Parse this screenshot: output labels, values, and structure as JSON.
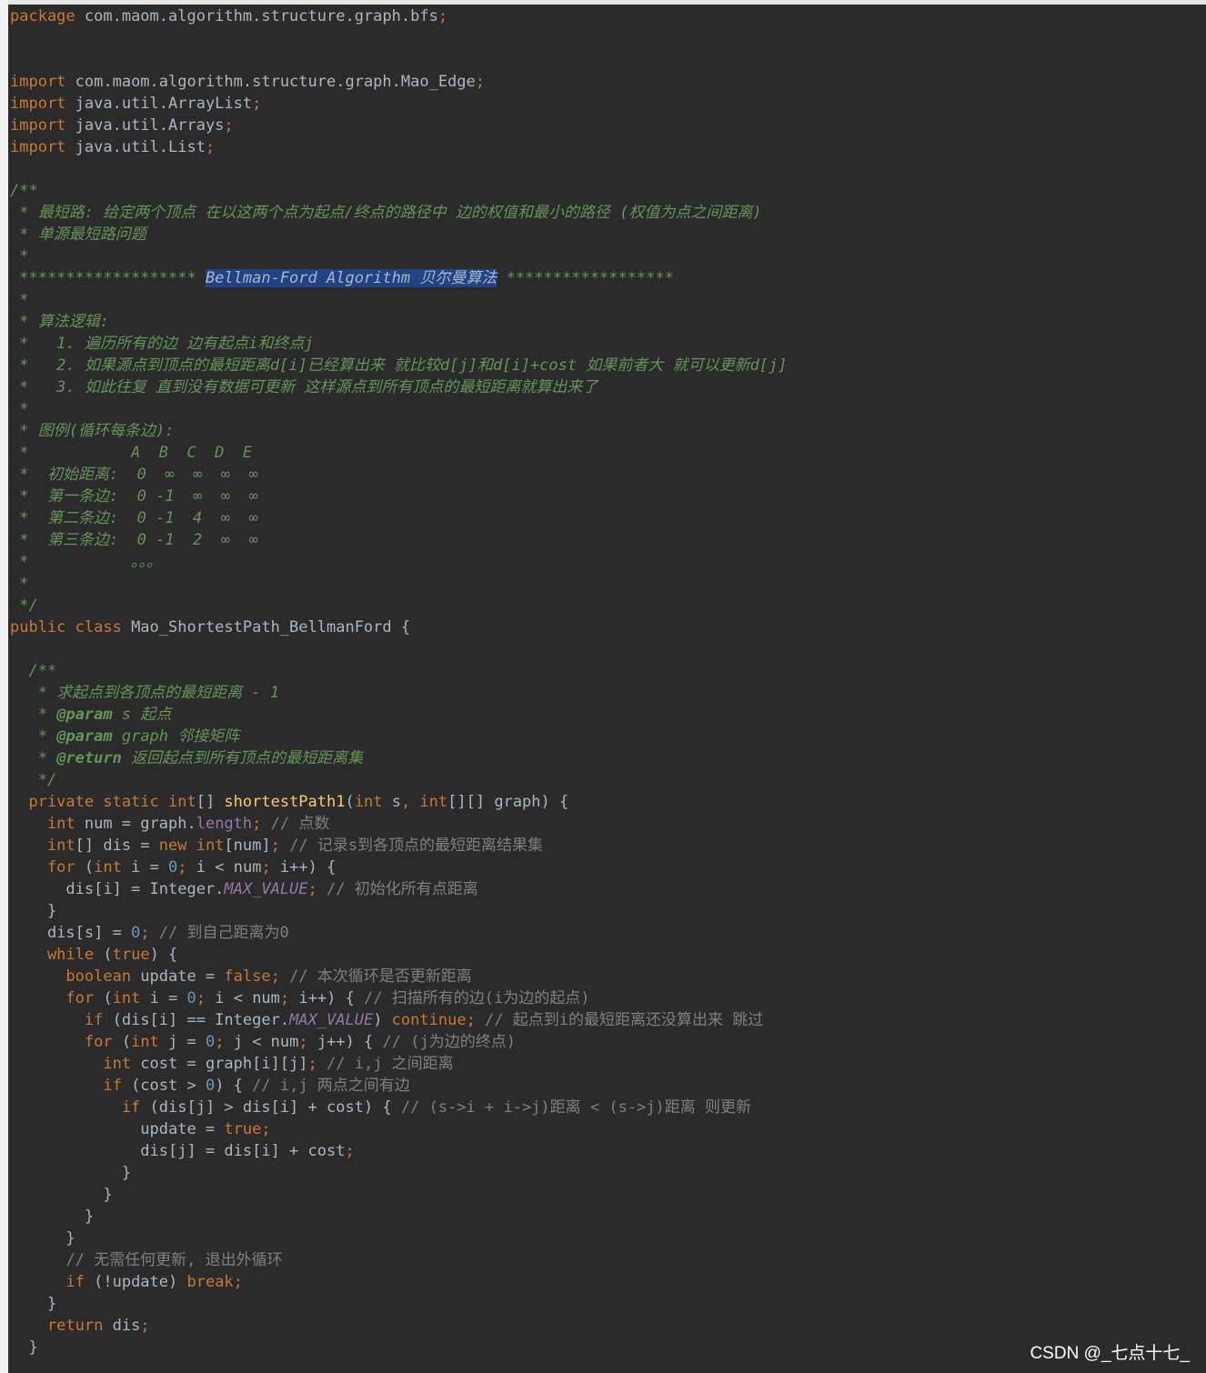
{
  "editor": {
    "lines": [
      [
        {
          "t": "package",
          "c": "kw"
        },
        {
          "t": " com.maom.algorithm.structure.graph.bfs",
          "c": "id"
        },
        {
          "t": ";",
          "c": "kw"
        }
      ],
      [],
      [],
      [
        {
          "t": "import",
          "c": "kw"
        },
        {
          "t": " com.maom.algorithm.structure.graph.Mao_Edge",
          "c": "id"
        },
        {
          "t": ";",
          "c": "kw"
        }
      ],
      [
        {
          "t": "import",
          "c": "kw"
        },
        {
          "t": " java.util.ArrayList",
          "c": "id"
        },
        {
          "t": ";",
          "c": "kw"
        }
      ],
      [
        {
          "t": "import",
          "c": "kw"
        },
        {
          "t": " java.util.Arrays",
          "c": "id"
        },
        {
          "t": ";",
          "c": "kw"
        }
      ],
      [
        {
          "t": "import",
          "c": "kw"
        },
        {
          "t": " java.util.List",
          "c": "id"
        },
        {
          "t": ";",
          "c": "kw"
        }
      ],
      [],
      [
        {
          "t": "/**",
          "c": "doc"
        }
      ],
      [
        {
          "t": " * 最短路: 给定两个顶点 在以这两个点为起点/终点的路径中 边的权值和最小的路径 (权值为点之间距离)",
          "c": "doc"
        }
      ],
      [
        {
          "t": " * 单源最短路问题",
          "c": "doc"
        }
      ],
      [
        {
          "t": " *",
          "c": "doc"
        }
      ],
      [
        {
          "t": " ******************* ",
          "c": "doc"
        },
        {
          "t": "Bellman-Ford Algorithm 贝尔曼算法",
          "c": "doc hl"
        },
        {
          "t": " ******************",
          "c": "doc"
        }
      ],
      [
        {
          "t": " *",
          "c": "doc"
        }
      ],
      [
        {
          "t": " * 算法逻辑:",
          "c": "doc"
        }
      ],
      [
        {
          "t": " *   1. 遍历所有的边 边有起点i和终点j",
          "c": "doc"
        }
      ],
      [
        {
          "t": " *   2. 如果源点到顶点的最短距离d[i]已经算出来 就比较d[j]和d[i]+cost 如果前者大 就可以更新d[j]",
          "c": "doc"
        }
      ],
      [
        {
          "t": " *   3. 如此往复 直到没有数据可更新 这样源点到所有顶点的最短距离就算出来了",
          "c": "doc"
        }
      ],
      [
        {
          "t": " *",
          "c": "doc"
        }
      ],
      [
        {
          "t": " * 图例(循环每条边):",
          "c": "doc"
        }
      ],
      [
        {
          "t": " *           A  B  C  D  E",
          "c": "doc"
        }
      ],
      [
        {
          "t": " *  初始距离:  0  ∞  ∞  ∞  ∞",
          "c": "doc"
        }
      ],
      [
        {
          "t": " *  第一条边:  0 -1  ∞  ∞  ∞",
          "c": "doc"
        }
      ],
      [
        {
          "t": " *  第二条边:  0 -1  4  ∞  ∞",
          "c": "doc"
        }
      ],
      [
        {
          "t": " *  第三条边:  0 -1  2  ∞  ∞",
          "c": "doc"
        }
      ],
      [
        {
          "t": " *           。。。",
          "c": "doc"
        }
      ],
      [
        {
          "t": " *",
          "c": "doc"
        }
      ],
      [
        {
          "t": " */",
          "c": "doc"
        }
      ],
      [
        {
          "t": "public class",
          "c": "kw"
        },
        {
          "t": " Mao_ShortestPath_BellmanFord {",
          "c": "id"
        }
      ],
      [],
      [
        {
          "t": "  /**",
          "c": "doc"
        }
      ],
      [
        {
          "t": "   * 求起点到各顶点的最短距离 - 1",
          "c": "doc"
        }
      ],
      [
        {
          "t": "   * ",
          "c": "doc"
        },
        {
          "t": "@param",
          "c": "tag"
        },
        {
          "t": " s 起点",
          "c": "doc"
        }
      ],
      [
        {
          "t": "   * ",
          "c": "doc"
        },
        {
          "t": "@param",
          "c": "tag"
        },
        {
          "t": " graph 邻接矩阵",
          "c": "doc"
        }
      ],
      [
        {
          "t": "   * ",
          "c": "doc"
        },
        {
          "t": "@return",
          "c": "tag"
        },
        {
          "t": " 返回起点到所有顶点的最短距离集",
          "c": "doc"
        }
      ],
      [
        {
          "t": "   */",
          "c": "doc"
        }
      ],
      [
        {
          "t": "  private static int",
          "c": "kw"
        },
        {
          "t": "[] ",
          "c": "id"
        },
        {
          "t": "shortestPath1",
          "c": "fn"
        },
        {
          "t": "(",
          "c": "id"
        },
        {
          "t": "int",
          "c": "kw"
        },
        {
          "t": " s",
          "c": "id"
        },
        {
          "t": ", ",
          "c": "kw"
        },
        {
          "t": "int",
          "c": "kw"
        },
        {
          "t": "[][] graph) {",
          "c": "id"
        }
      ],
      [
        {
          "t": "    int",
          "c": "kw"
        },
        {
          "t": " num = graph.",
          "c": "id"
        },
        {
          "t": "length",
          "c": "field"
        },
        {
          "t": "; ",
          "c": "kw"
        },
        {
          "t": "// 点数",
          "c": "cm"
        }
      ],
      [
        {
          "t": "    int",
          "c": "kw"
        },
        {
          "t": "[] dis = ",
          "c": "id"
        },
        {
          "t": "new int",
          "c": "kw"
        },
        {
          "t": "[num]",
          "c": "id"
        },
        {
          "t": "; ",
          "c": "kw"
        },
        {
          "t": "// 记录s到各顶点的最短距离结果集",
          "c": "cm"
        }
      ],
      [
        {
          "t": "    for",
          "c": "kw"
        },
        {
          "t": " (",
          "c": "id"
        },
        {
          "t": "int",
          "c": "kw"
        },
        {
          "t": " i = ",
          "c": "id"
        },
        {
          "t": "0",
          "c": "num"
        },
        {
          "t": "; ",
          "c": "kw"
        },
        {
          "t": "i < num",
          "c": "id"
        },
        {
          "t": "; ",
          "c": "kw"
        },
        {
          "t": "i++) {",
          "c": "id"
        }
      ],
      [
        {
          "t": "      dis[i] = Integer.",
          "c": "id"
        },
        {
          "t": "MAX_VALUE",
          "c": "cst"
        },
        {
          "t": "; ",
          "c": "kw"
        },
        {
          "t": "// 初始化所有点距离",
          "c": "cm"
        }
      ],
      [
        {
          "t": "    }",
          "c": "id"
        }
      ],
      [
        {
          "t": "    dis[s] = ",
          "c": "id"
        },
        {
          "t": "0",
          "c": "num"
        },
        {
          "t": "; ",
          "c": "kw"
        },
        {
          "t": "// 到自己距离为0",
          "c": "cm"
        }
      ],
      [
        {
          "t": "    while",
          "c": "kw"
        },
        {
          "t": " (",
          "c": "id"
        },
        {
          "t": "true",
          "c": "kw"
        },
        {
          "t": ") {",
          "c": "id"
        }
      ],
      [
        {
          "t": "      boolean",
          "c": "kw"
        },
        {
          "t": " update = ",
          "c": "id"
        },
        {
          "t": "false",
          "c": "kw"
        },
        {
          "t": "; ",
          "c": "kw"
        },
        {
          "t": "// 本次循环是否更新距离",
          "c": "cm"
        }
      ],
      [
        {
          "t": "      for",
          "c": "kw"
        },
        {
          "t": " (",
          "c": "id"
        },
        {
          "t": "int",
          "c": "kw"
        },
        {
          "t": " i = ",
          "c": "id"
        },
        {
          "t": "0",
          "c": "num"
        },
        {
          "t": "; ",
          "c": "kw"
        },
        {
          "t": "i < num",
          "c": "id"
        },
        {
          "t": "; ",
          "c": "kw"
        },
        {
          "t": "i++) { ",
          "c": "id"
        },
        {
          "t": "// 扫描所有的边(i为边的起点)",
          "c": "cm"
        }
      ],
      [
        {
          "t": "        if",
          "c": "kw"
        },
        {
          "t": " (dis[i] == Integer.",
          "c": "id"
        },
        {
          "t": "MAX_VALUE",
          "c": "cst"
        },
        {
          "t": ") ",
          "c": "id"
        },
        {
          "t": "continue",
          "c": "kw"
        },
        {
          "t": "; ",
          "c": "kw"
        },
        {
          "t": "// 起点到i的最短距离还没算出来 跳过",
          "c": "cm"
        }
      ],
      [
        {
          "t": "        for",
          "c": "kw"
        },
        {
          "t": " (",
          "c": "id"
        },
        {
          "t": "int",
          "c": "kw"
        },
        {
          "t": " j = ",
          "c": "id"
        },
        {
          "t": "0",
          "c": "num"
        },
        {
          "t": "; ",
          "c": "kw"
        },
        {
          "t": "j < num",
          "c": "id"
        },
        {
          "t": "; ",
          "c": "kw"
        },
        {
          "t": "j++) { ",
          "c": "id"
        },
        {
          "t": "// (j为边的终点)",
          "c": "cm"
        }
      ],
      [
        {
          "t": "          int",
          "c": "kw"
        },
        {
          "t": " cost = graph[i][j]",
          "c": "id"
        },
        {
          "t": "; ",
          "c": "kw"
        },
        {
          "t": "// i,j 之间距离",
          "c": "cm"
        }
      ],
      [
        {
          "t": "          if",
          "c": "kw"
        },
        {
          "t": " (cost > ",
          "c": "id"
        },
        {
          "t": "0",
          "c": "num"
        },
        {
          "t": ") { ",
          "c": "id"
        },
        {
          "t": "// i,j 两点之间有边",
          "c": "cm"
        }
      ],
      [
        {
          "t": "            if",
          "c": "kw"
        },
        {
          "t": " (dis[j] > dis[i] + cost) { ",
          "c": "id"
        },
        {
          "t": "// (s->i + i->j)距离 < (s->j)距离 则更新",
          "c": "cm"
        }
      ],
      [
        {
          "t": "              update = ",
          "c": "id"
        },
        {
          "t": "true",
          "c": "kw"
        },
        {
          "t": ";",
          "c": "kw"
        }
      ],
      [
        {
          "t": "              dis[j] = dis[i] + cost",
          "c": "id"
        },
        {
          "t": ";",
          "c": "kw"
        }
      ],
      [
        {
          "t": "            }",
          "c": "id"
        }
      ],
      [
        {
          "t": "          }",
          "c": "id"
        }
      ],
      [
        {
          "t": "        }",
          "c": "id"
        }
      ],
      [
        {
          "t": "      }",
          "c": "id"
        }
      ],
      [
        {
          "t": "      // 无需任何更新, 退出外循环",
          "c": "cm"
        }
      ],
      [
        {
          "t": "      if",
          "c": "kw"
        },
        {
          "t": " (!update) ",
          "c": "id"
        },
        {
          "t": "break",
          "c": "kw"
        },
        {
          "t": ";",
          "c": "kw"
        }
      ],
      [
        {
          "t": "    }",
          "c": "id"
        }
      ],
      [
        {
          "t": "    return",
          "c": "kw"
        },
        {
          "t": " dis",
          "c": "id"
        },
        {
          "t": ";",
          "c": "kw"
        }
      ],
      [
        {
          "t": "  }",
          "c": "id"
        }
      ]
    ]
  },
  "watermark": "CSDN @_七点十七_"
}
